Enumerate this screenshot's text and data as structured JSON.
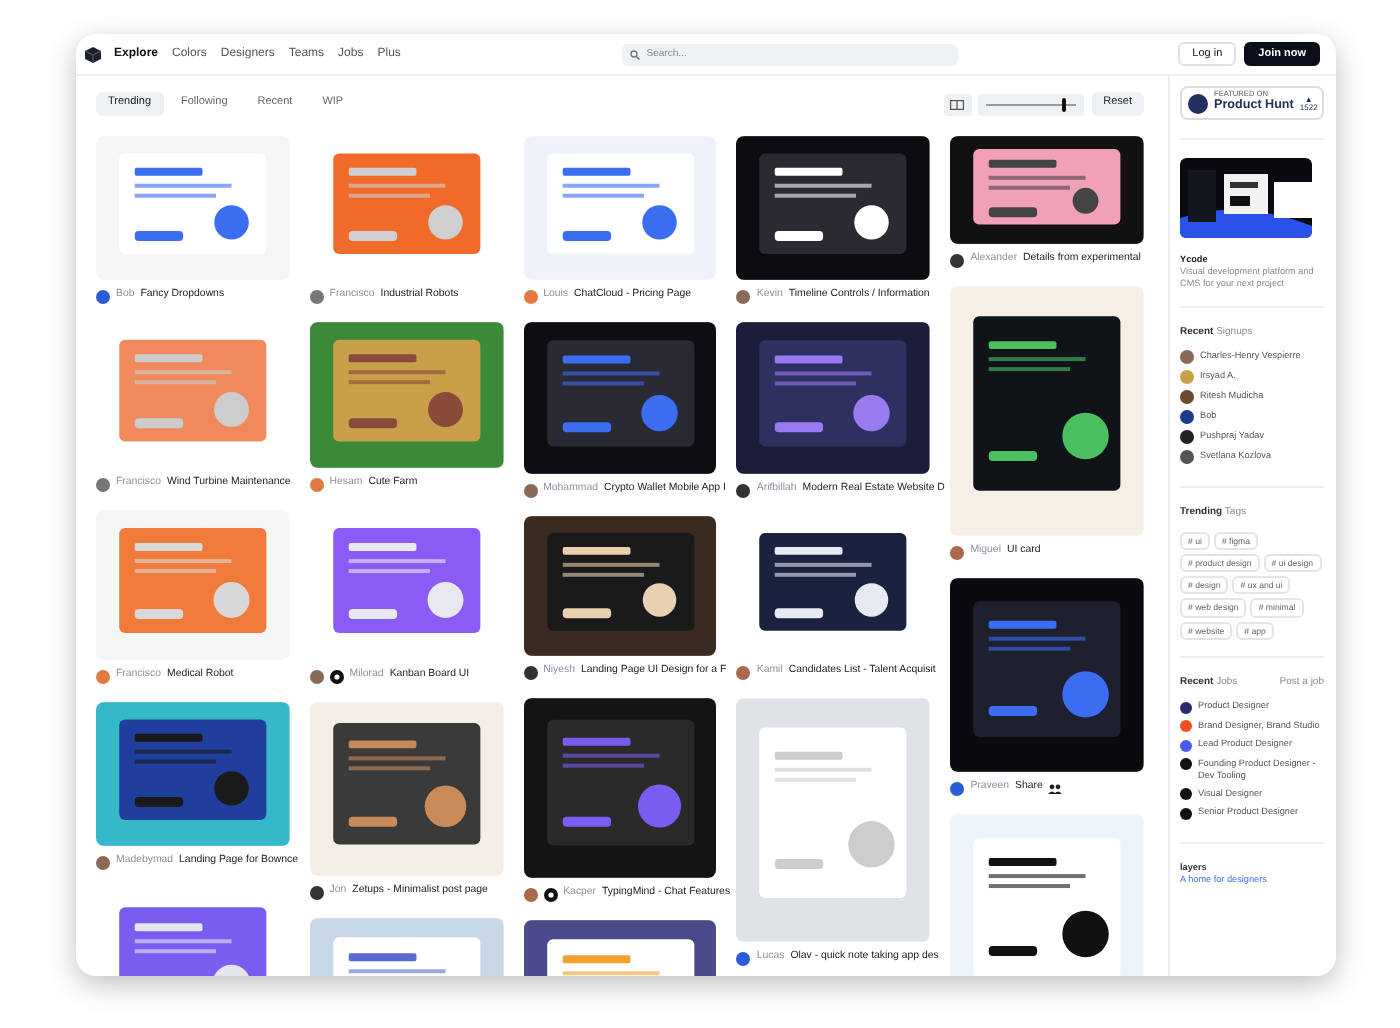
{
  "header": {
    "nav": [
      {
        "label": "Explore",
        "selected": true
      },
      {
        "label": "Colors",
        "selected": false
      },
      {
        "label": "Designers",
        "selected": false
      },
      {
        "label": "Teams",
        "selected": false
      },
      {
        "label": "Jobs",
        "selected": false
      },
      {
        "label": "Plus",
        "selected": false
      }
    ],
    "search": {
      "placeholder": "Search..."
    },
    "buttons": [
      {
        "label": "Log in",
        "kind": "outline"
      },
      {
        "label": "Join now",
        "kind": "solid"
      }
    ]
  },
  "filters": {
    "tabs": [
      {
        "label": "Trending",
        "selected": true
      },
      {
        "label": "Following",
        "selected": false
      },
      {
        "label": "Recent",
        "selected": false
      },
      {
        "label": "WIP",
        "selected": false
      }
    ],
    "size_slider": {
      "level": 0.85
    },
    "reset": "Reset"
  },
  "columns": [
    [
      {
        "kind": "picture",
        "author": "Bob",
        "title": "Fancy Dropdowns"
      },
      {
        "kind": "picture",
        "author": "Francisco",
        "title": "Wind Turbine Maintenance"
      },
      {
        "kind": "picture",
        "author": "Francisco",
        "title": "Medical Robot"
      },
      {
        "kind": "picture",
        "author": "Madebymad",
        "title": "Landing Page for Bownce"
      },
      {
        "kind": "picture"
      }
    ],
    [
      {
        "kind": "picture",
        "author": "Francisco",
        "title": "Industrial Robots"
      },
      {
        "kind": "picture",
        "author": "Hesam",
        "title": "Cute Farm"
      },
      {
        "kind": "picture",
        "author": "Milorad",
        "title": "Kanban Board UI",
        "team": true
      },
      {
        "kind": "picture",
        "author": "Jon",
        "title": "Zetups - Minimalist post page"
      },
      {
        "kind": "picture"
      }
    ],
    [
      {
        "kind": "picture",
        "author": "Louis",
        "title": "ChatCloud - Pricing Page"
      },
      {
        "kind": "picture",
        "author": "Mohammad",
        "title": "Crypto Wallet Mobile App I"
      },
      {
        "kind": "picture",
        "author": "Niyesh",
        "title": "Landing Page UI Design for a F"
      },
      {
        "kind": "picture",
        "author": "Kacper",
        "title": "TypingMind - Chat Features",
        "team": true
      },
      {
        "kind": "picture"
      }
    ],
    [
      {
        "kind": "picture",
        "author": "Kevin",
        "title": "Timeline Controls / Information"
      },
      {
        "kind": "picture",
        "author": "Arifbillah",
        "title": "Modern Real Estate Website D"
      },
      {
        "kind": "picture",
        "author": "Kamil",
        "title": "Candidates List - Talent Acquisit"
      },
      {
        "kind": "picture",
        "author": "Lucas",
        "title": "Olav - quick note taking app des"
      }
    ],
    [
      {
        "kind": "picture",
        "author": "Alexander",
        "title": "Details from experimental"
      },
      {
        "kind": "picture",
        "author": "Miguel",
        "title": "UI card"
      },
      {
        "kind": "picture",
        "author": "Praveen",
        "title": "Share",
        "title_icon": true
      },
      {
        "kind": "picture"
      }
    ]
  ],
  "sidebar": {
    "product_hunt": {
      "eyebrow": "FEATURED ON",
      "name": "Product Hunt",
      "arrow": "▲",
      "votes": "1522"
    },
    "ad": {
      "kind": "picture",
      "title": "Ycode",
      "text": "Visual development platform and CMS for your next project"
    },
    "signups": {
      "heading": "**Recent** Signups",
      "people": [
        {
          "name": "Charles-Henry Vespierre",
          "color": "#8a6a55"
        },
        {
          "name": "Irsyad A.",
          "color": "#c9a04a"
        },
        {
          "name": "Ritesh Mudicha",
          "color": "#6b4a2e"
        },
        {
          "name": "Bob",
          "color": "#1d3a8a"
        },
        {
          "name": "Pushpraj Yadav",
          "color": "#222222"
        },
        {
          "name": "Svetlana Kozlova",
          "color": "#555555"
        }
      ]
    },
    "tags": {
      "heading": "**Trending** Tags",
      "items": [
        "# ui",
        "# figma",
        "# product design",
        "# ui design",
        "# design",
        "# ux and ui",
        "# web design",
        "# minimal",
        "# website",
        "# app"
      ]
    },
    "jobs": {
      "heading": "**Recent** Jobs",
      "link": "Post a job",
      "items": [
        {
          "title": "Product Designer",
          "color": "#2b2b6e"
        },
        {
          "title": "Brand Designer, Brand Studio",
          "color": "#f24e1e"
        },
        {
          "title": "Lead Product Designer",
          "color": "#4a5bf0"
        },
        {
          "title": "Founding Product Designer - Dev Tooling",
          "color": "#111111"
        },
        {
          "title": "Visual Designer",
          "color": "#111111"
        },
        {
          "title": "Senior Product Designer",
          "color": "#111111"
        }
      ]
    },
    "footer": {
      "title": "layers",
      "text": "A home for designers"
    }
  }
}
